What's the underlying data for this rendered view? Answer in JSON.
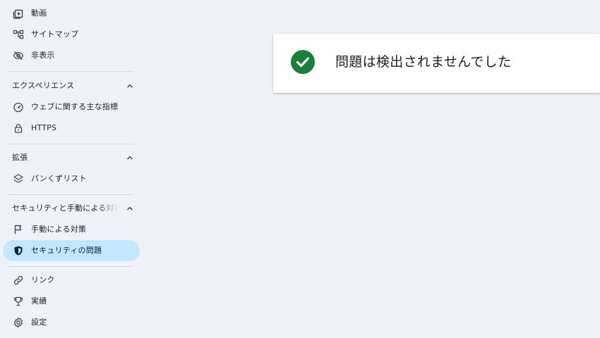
{
  "sidebar": {
    "top_items": [
      {
        "label": "動画",
        "icon": "video-icon"
      },
      {
        "label": "サイトマップ",
        "icon": "sitemap-icon"
      },
      {
        "label": "非表示",
        "icon": "eye-off-icon"
      }
    ],
    "sections": [
      {
        "title": "エクスペリエンス",
        "items": [
          {
            "label": "ウェブに関する主な指標",
            "icon": "speedometer-icon"
          },
          {
            "label": "HTTPS",
            "icon": "lock-icon"
          }
        ]
      },
      {
        "title": "拡張",
        "items": [
          {
            "label": "パンくずリスト",
            "icon": "layers-icon"
          }
        ]
      },
      {
        "title": "セキュリティと手動による対策",
        "items": [
          {
            "label": "手動による対策",
            "icon": "flag-icon"
          },
          {
            "label": "セキュリティの問題",
            "icon": "shield-icon",
            "active": true
          }
        ]
      }
    ],
    "bottom_items": [
      {
        "label": "リンク",
        "icon": "link-icon"
      },
      {
        "label": "実績",
        "icon": "trophy-icon"
      },
      {
        "label": "設定",
        "icon": "gear-icon"
      }
    ]
  },
  "main": {
    "status_message": "問題は検出されませんでした",
    "status_icon": "check-circle-icon"
  },
  "colors": {
    "background": "#eff2f8",
    "active_item": "#c2e7ff",
    "success_green": "#188038",
    "card": "#ffffff"
  }
}
